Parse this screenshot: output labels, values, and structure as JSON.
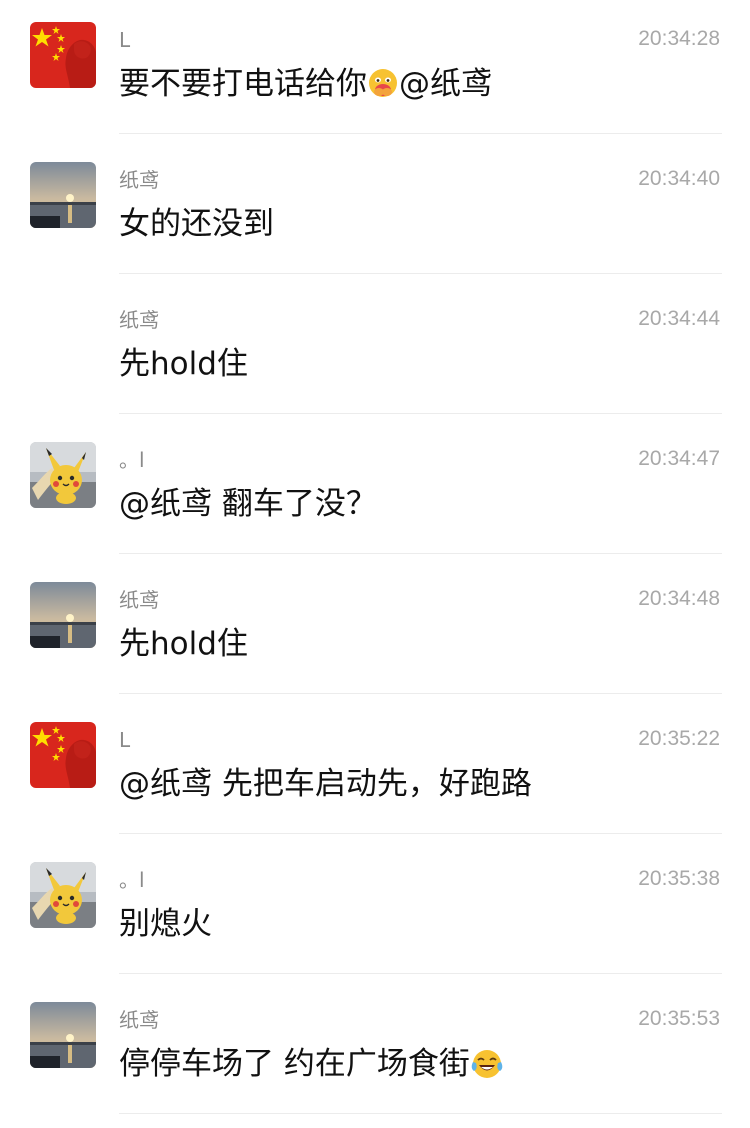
{
  "messages": [
    {
      "sender": "L",
      "time": "20:34:28",
      "text_before": "要不要打电话给你",
      "emoji": "face-with-hand-over-mouth-emoji",
      "text_after": "@纸鸢",
      "avatar": "china-flag-silhouette-avatar"
    },
    {
      "sender": "纸鸢",
      "time": "20:34:40",
      "text_before": "女的还没到",
      "avatar": "sunset-lake-avatar"
    },
    {
      "sender": "纸鸢",
      "time": "20:34:44",
      "text_before": "先hold住"
    },
    {
      "sender": "。l",
      "time": "20:34:47",
      "text_before": "@纸鸢 翻车了没？",
      "avatar": "pikachu-avatar"
    },
    {
      "sender": "纸鸢",
      "time": "20:34:48",
      "text_before": "先hold住",
      "avatar": "sunset-lake-avatar"
    },
    {
      "sender": "L",
      "time": "20:35:22",
      "text_before": "@纸鸢 先把车启动先，好跑路",
      "avatar": "china-flag-silhouette-avatar"
    },
    {
      "sender": "。l",
      "time": "20:35:38",
      "text_before": "别熄火",
      "avatar": "pikachu-avatar"
    },
    {
      "sender": "纸鸢",
      "time": "20:35:53",
      "text_before": "停停车场了 约在广场食街",
      "emoji": "tears-of-joy-emoji",
      "avatar": "sunset-lake-avatar"
    }
  ],
  "colors": {
    "flag_red": "#d8261d",
    "flag_star": "#ffde00",
    "emoji_yellow": "#f7c231",
    "timestamp_gray": "#a8a8a8",
    "sender_gray": "#8a8a8a"
  }
}
